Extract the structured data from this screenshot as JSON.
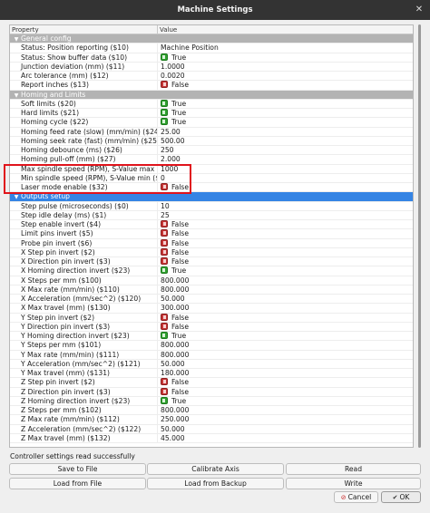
{
  "window": {
    "title": "Machine Settings"
  },
  "table": {
    "headers": {
      "property": "Property",
      "value": "Value"
    },
    "rows": [
      {
        "type": "group",
        "name": "General config",
        "expanded": true
      },
      {
        "prop": "Status: Position reporting ($10)",
        "value": "Machine Position"
      },
      {
        "prop": "Status: Show buffer data ($10)",
        "bool": true,
        "value": "True"
      },
      {
        "prop": "Junction deviation (mm) ($11)",
        "value": "1.0000"
      },
      {
        "prop": "Arc tolerance (mm) ($12)",
        "value": "0.0020"
      },
      {
        "prop": "Report inches ($13)",
        "bool": false,
        "value": "False"
      },
      {
        "type": "group",
        "name": "Homing and Limits",
        "expanded": true
      },
      {
        "prop": "Soft limits ($20)",
        "bool": true,
        "value": "True"
      },
      {
        "prop": "Hard limits ($21)",
        "bool": true,
        "value": "True"
      },
      {
        "prop": "Homing cycle ($22)",
        "bool": true,
        "value": "True"
      },
      {
        "prop": "Homing feed rate (slow) (mm/min) ($24)",
        "value": "25.00"
      },
      {
        "prop": "Homing seek rate (fast) (mm/min) ($25)",
        "value": "500.00"
      },
      {
        "prop": "Homing debounce (ms) ($26)",
        "value": "250"
      },
      {
        "prop": "Homing pull-off (mm) ($27)",
        "value": "2.000"
      },
      {
        "prop": "Max spindle speed (RPM), S-Value max ($30)",
        "value": "1000"
      },
      {
        "prop": "Min spindle speed (RPM), S-Value min ($31)",
        "value": "0"
      },
      {
        "prop": "Laser mode enable ($32)",
        "bool": false,
        "value": "False"
      },
      {
        "type": "group",
        "name": "Outputs setup",
        "expanded": true,
        "selected": true
      },
      {
        "prop": "Step pulse (microseconds) ($0)",
        "value": "10"
      },
      {
        "prop": "Step idle delay (ms) ($1)",
        "value": "25"
      },
      {
        "prop": "Step enable invert ($4)",
        "bool": false,
        "value": "False"
      },
      {
        "prop": "Limit pins invert ($5)",
        "bool": false,
        "value": "False"
      },
      {
        "prop": "Probe pin invert ($6)",
        "bool": false,
        "value": "False"
      },
      {
        "prop": "X Step pin invert ($2)",
        "bool": false,
        "value": "False"
      },
      {
        "prop": "X Direction pin invert ($3)",
        "bool": false,
        "value": "False"
      },
      {
        "prop": "X Homing direction invert ($23)",
        "bool": true,
        "value": "True"
      },
      {
        "prop": "X Steps per mm ($100)",
        "value": "800.000"
      },
      {
        "prop": "X Max rate (mm/min) ($110)",
        "value": "800.000"
      },
      {
        "prop": "X Acceleration (mm/sec^2) ($120)",
        "value": "50.000"
      },
      {
        "prop": "X Max travel (mm) ($130)",
        "value": "300.000"
      },
      {
        "prop": "Y Step pin invert ($2)",
        "bool": false,
        "value": "False"
      },
      {
        "prop": "Y Direction pin invert ($3)",
        "bool": false,
        "value": "False"
      },
      {
        "prop": "Y Homing direction invert ($23)",
        "bool": true,
        "value": "True"
      },
      {
        "prop": "Y Steps per mm ($101)",
        "value": "800.000"
      },
      {
        "prop": "Y Max rate (mm/min) ($111)",
        "value": "800.000"
      },
      {
        "prop": "Y Acceleration (mm/sec^2) ($121)",
        "value": "50.000"
      },
      {
        "prop": "Y Max travel (mm) ($131)",
        "value": "180.000"
      },
      {
        "prop": "Z Step pin invert ($2)",
        "bool": false,
        "value": "False"
      },
      {
        "prop": "Z Direction pin invert ($3)",
        "bool": false,
        "value": "False"
      },
      {
        "prop": "Z Homing direction invert ($23)",
        "bool": true,
        "value": "True"
      },
      {
        "prop": "Z Steps per mm ($102)",
        "value": "800.000"
      },
      {
        "prop": "Z Max rate (mm/min) ($112)",
        "value": "250.000"
      },
      {
        "prop": "Z Acceleration (mm/sec^2) ($122)",
        "value": "50.000"
      },
      {
        "prop": "Z Max travel (mm) ($132)",
        "value": "45.000"
      }
    ]
  },
  "status": {
    "text": "Controller settings read successfully"
  },
  "buttons": {
    "save_to_file": "Save to File",
    "calibrate_axis": "Calibrate Axis",
    "read": "Read",
    "load_from_file": "Load from File",
    "load_from_backup": "Load from Backup",
    "write": "Write",
    "cancel": "Cancel",
    "ok": "OK"
  },
  "icons": {
    "close": "close-icon",
    "toggle_on": "toggle-on-icon",
    "toggle_off": "toggle-off-icon",
    "cancel": "cancel-icon",
    "ok": "checkmark-icon"
  },
  "colors": {
    "titlebar": "#333333",
    "group_row": "#b3b3b3",
    "selected_row": "#3584e4",
    "toggle_on": "#2fa12f",
    "toggle_off": "#c63535",
    "annotation": "#e0141c"
  }
}
